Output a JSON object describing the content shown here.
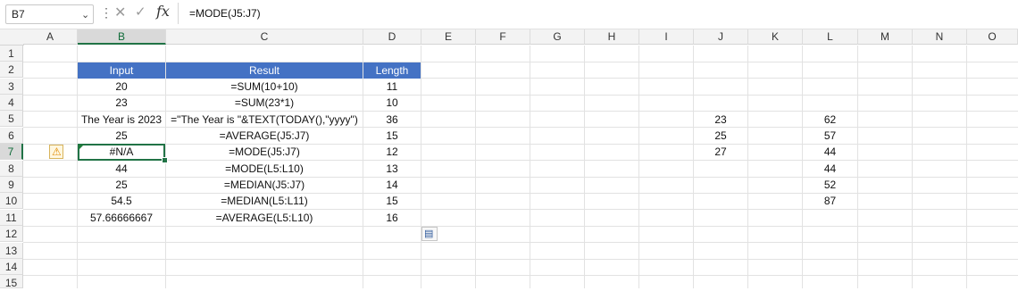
{
  "formula_bar": {
    "name_box": "B7",
    "formula": "=MODE(J5:J7)",
    "cancel_glyph": "✕",
    "enter_glyph": "✓",
    "fx_label": "fx",
    "more_glyph": "⋮",
    "dropdown_glyph": "⌄"
  },
  "columns": [
    "A",
    "B",
    "C",
    "D",
    "E",
    "F",
    "G",
    "H",
    "I",
    "J",
    "K",
    "L",
    "M",
    "N",
    "O"
  ],
  "rows": [
    "1",
    "2",
    "3",
    "4",
    "5",
    "6",
    "7",
    "8",
    "9",
    "10",
    "11",
    "12",
    "13",
    "14",
    "15"
  ],
  "table": {
    "headers": [
      "Input",
      "Result",
      "Length"
    ],
    "rows": [
      {
        "input": "20",
        "result": "=SUM(10+10)",
        "length": "11"
      },
      {
        "input": "23",
        "result": "=SUM(23*1)",
        "length": "10"
      },
      {
        "input": "The Year is 2023",
        "result": "=\"The Year is \"&TEXT(TODAY(),\"yyyy\")",
        "length": "36"
      },
      {
        "input": "25",
        "result": "=AVERAGE(J5:J7)",
        "length": "15"
      },
      {
        "input": "#N/A",
        "result": "=MODE(J5:J7)",
        "length": "12"
      },
      {
        "input": "44",
        "result": "=MODE(L5:L10)",
        "length": "13"
      },
      {
        "input": "25",
        "result": "=MEDIAN(J5:J7)",
        "length": "14"
      },
      {
        "input": "54.5",
        "result": "=MEDIAN(L5:L11)",
        "length": "15"
      },
      {
        "input": "57.66666667",
        "result": "=AVERAGE(L5:L10)",
        "length": "16"
      }
    ]
  },
  "col_j": [
    "23",
    "25",
    "27"
  ],
  "col_l": [
    "62",
    "57",
    "44",
    "44",
    "52",
    "87"
  ],
  "icons": {
    "warning": "⚠",
    "paste_options": "▤"
  },
  "colors": {
    "header_fill": "#4472c4",
    "header_text": "#ffffff",
    "selection": "#217346"
  }
}
